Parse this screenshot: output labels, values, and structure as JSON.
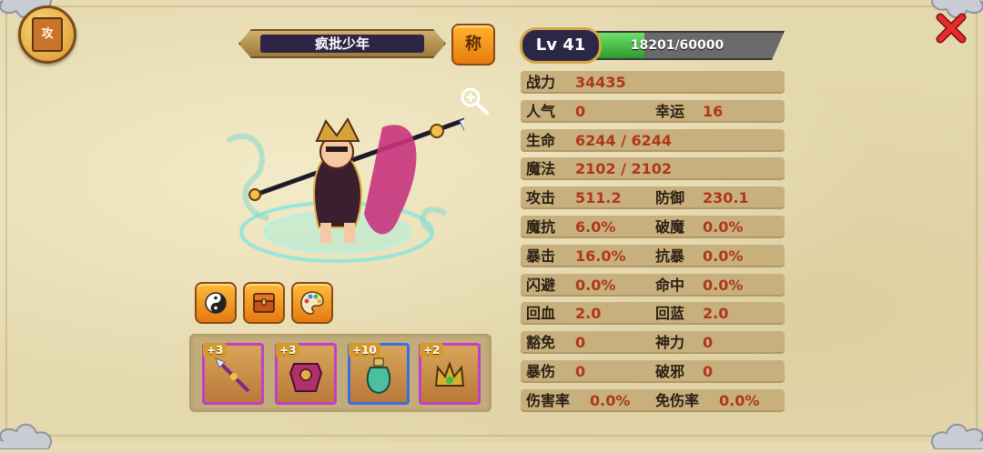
{
  "header": {
    "book_label": "攻",
    "character_name": "疯批少年",
    "title_button_label": "称"
  },
  "level": {
    "label": "Lv 41",
    "xp_text": "18201/60000",
    "xp_current": 18201,
    "xp_max": 60000
  },
  "stats": [
    {
      "label": "战力",
      "value": "34435"
    },
    {
      "label": "人气",
      "value": "0",
      "label2": "幸运",
      "value2": "16"
    },
    {
      "label": "生命",
      "value": "6244 / 6244"
    },
    {
      "label": "魔法",
      "value": "2102 / 2102"
    },
    {
      "label": "攻击",
      "value": "511.2",
      "label2": "防御",
      "value2": "230.1"
    },
    {
      "label": "魔抗",
      "value": "6.0%",
      "label2": "破魔",
      "value2": "0.0%"
    },
    {
      "label": "暴击",
      "value": "16.0%",
      "label2": "抗暴",
      "value2": "0.0%"
    },
    {
      "label": "闪避",
      "value": "0.0%",
      "label2": "命中",
      "value2": "0.0%"
    },
    {
      "label": "回血",
      "value": "2.0",
      "label2": "回蓝",
      "value2": "2.0"
    },
    {
      "label": "豁免",
      "value": "0",
      "label2": "神力",
      "value2": "0"
    },
    {
      "label": "暴伤",
      "value": "0",
      "label2": "破邪",
      "value2": "0"
    },
    {
      "label": "伤害率",
      "value": "0.0%",
      "label2": "免伤率",
      "value2": "0.0%"
    }
  ],
  "equipment": [
    {
      "plus": "+3",
      "rarity": "purple",
      "icon": "spear-icon"
    },
    {
      "plus": "+3",
      "rarity": "purple",
      "icon": "armor-icon"
    },
    {
      "plus": "+10",
      "rarity": "blue",
      "icon": "gourd-icon"
    },
    {
      "plus": "+2",
      "rarity": "purple",
      "icon": "crown-icon"
    }
  ],
  "action_icons": [
    "yin-yang-icon",
    "chest-icon",
    "palette-icon"
  ],
  "colors": {
    "stat_value": "#b0361a",
    "stat_label": "#2a1e12",
    "xp_fill": "#2e9c2c",
    "button_orange": "#e87a10"
  }
}
